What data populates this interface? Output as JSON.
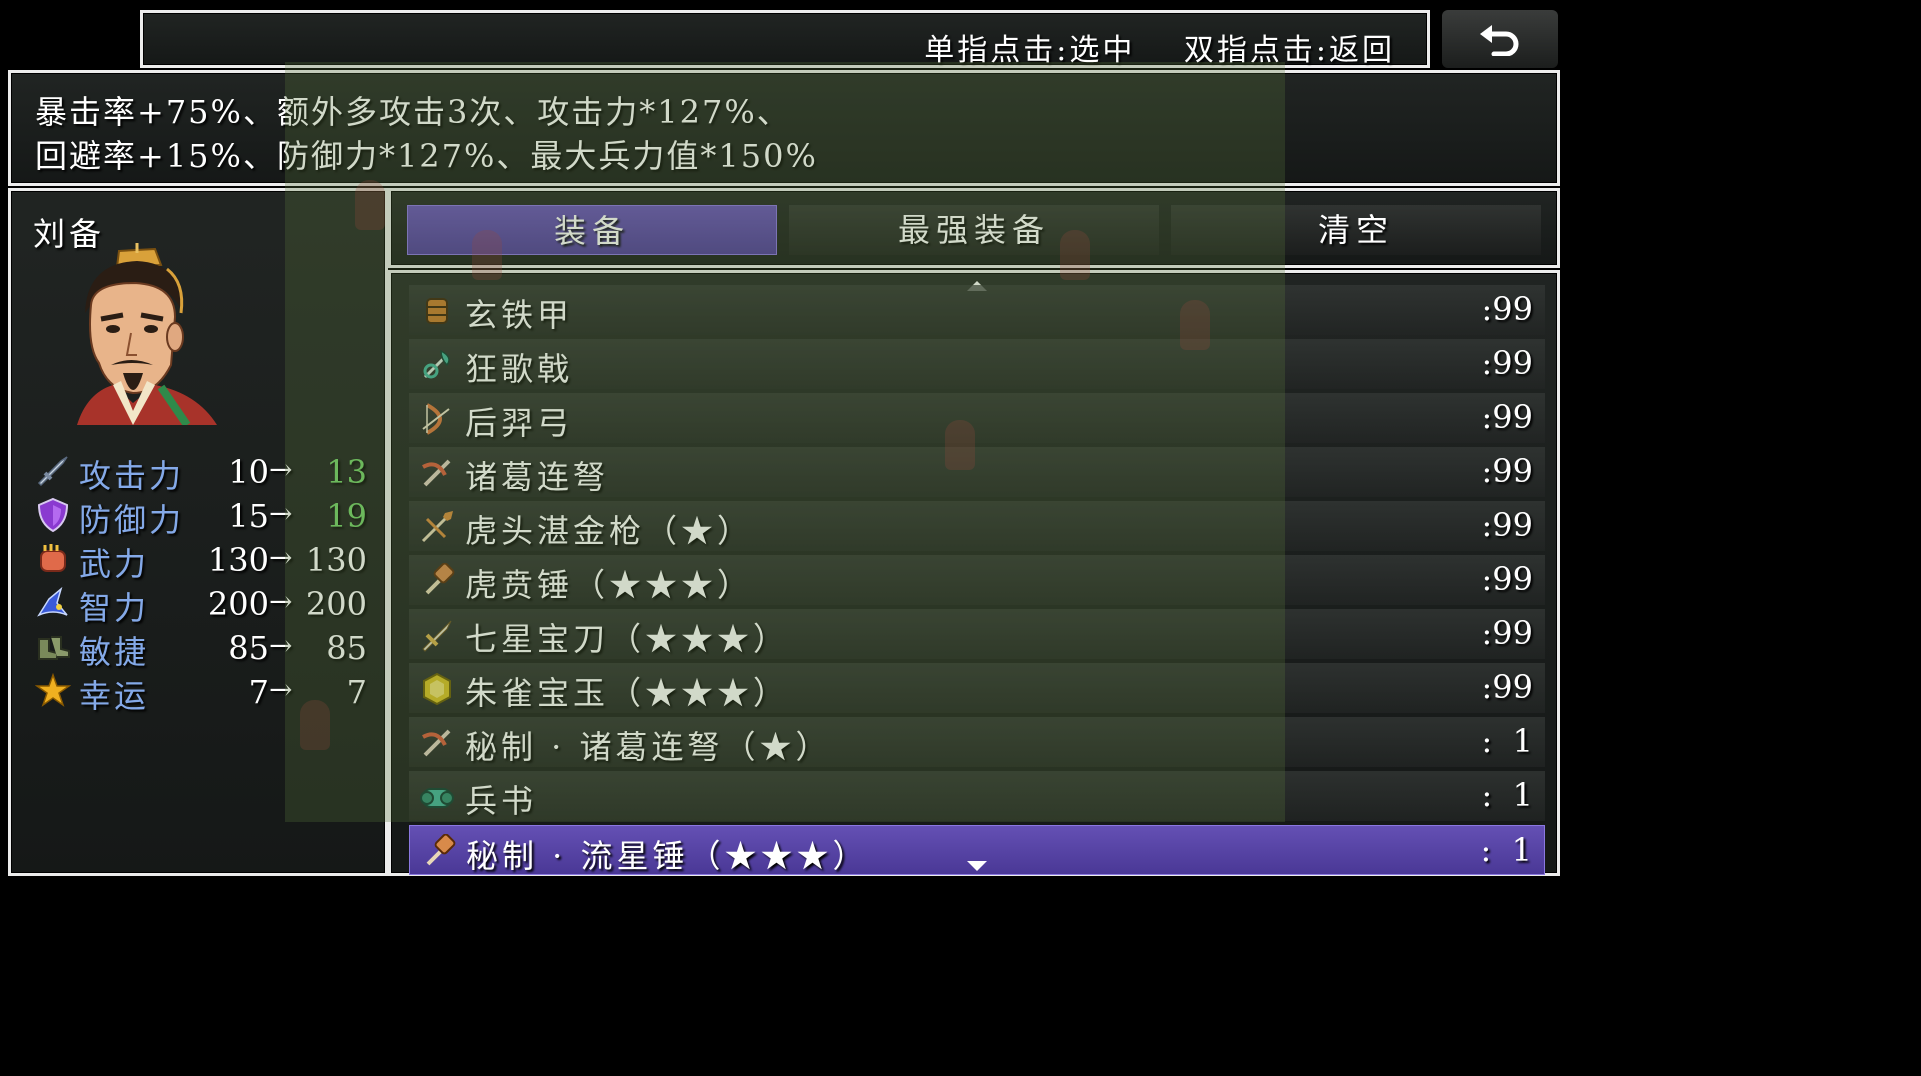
{
  "help": {
    "single_tap": "单指点击:选中",
    "double_tap": "双指点击:返回"
  },
  "description": {
    "line1": "暴击率+75%、额外多攻击3次、攻击力*127%、",
    "line2": "回避率+15%、防御力*127%、最大兵力值*150%"
  },
  "actor": {
    "name": "刘备",
    "stats": [
      {
        "label": "攻击力",
        "icon": "sword-icon",
        "old": "10",
        "arrow": "→",
        "new": "13",
        "up": true
      },
      {
        "label": "防御力",
        "icon": "shield-icon",
        "old": "15",
        "arrow": "→",
        "new": "19",
        "up": true
      },
      {
        "label": "武力",
        "icon": "fist-icon",
        "old": "130",
        "arrow": "→",
        "new": "130",
        "up": false
      },
      {
        "label": "智力",
        "icon": "wizard-hat-icon",
        "old": "200",
        "arrow": "→",
        "new": "200",
        "up": false
      },
      {
        "label": "敏捷",
        "icon": "boots-icon",
        "old": "85",
        "arrow": "→",
        "new": "85",
        "up": false
      },
      {
        "label": "幸运",
        "icon": "star-icon",
        "old": "7",
        "arrow": "→",
        "new": "7",
        "up": false
      }
    ]
  },
  "commands": [
    "装备",
    "最强装备",
    "清空"
  ],
  "items": [
    {
      "name": "玄铁甲",
      "icon": "armor-icon",
      "count": ":99",
      "color": "#c77a2a"
    },
    {
      "name": "狂歌戟",
      "icon": "halberd-icon",
      "count": ":99",
      "color": "#3fb39a"
    },
    {
      "name": "后羿弓",
      "icon": "bow-icon",
      "count": ":99",
      "color": "#d9743a"
    },
    {
      "name": "诸葛连弩",
      "icon": "crossbow-icon",
      "count": ":99",
      "color": "#d85a3a"
    },
    {
      "name": "虎头湛金枪（★）",
      "icon": "spear-icon",
      "count": ":99",
      "color": "#d68a3a"
    },
    {
      "name": "虎贲锤（★★★）",
      "icon": "hammer-icon",
      "count": ":99",
      "color": "#d88a4a"
    },
    {
      "name": "七星宝刀（★★★）",
      "icon": "sword-icon",
      "count": ":99",
      "color": "#d8b04a"
    },
    {
      "name": "朱雀宝玉（★★★）",
      "icon": "jade-icon",
      "count": ":99",
      "color": "#d8c020"
    },
    {
      "name": "秘制 · 诸葛连弩（★）",
      "icon": "crossbow-icon",
      "count": ":  1",
      "color": "#d85a3a"
    },
    {
      "name": "兵书",
      "icon": "scroll-book-icon",
      "count": ":  1",
      "color": "#3fb39a"
    },
    {
      "name": "秘制 · 流星锤（★★★）",
      "icon": "hammer-icon",
      "count": ":  1",
      "color": "#d88a4a"
    }
  ],
  "selected_item_index": 10,
  "selected_command_index": 0
}
